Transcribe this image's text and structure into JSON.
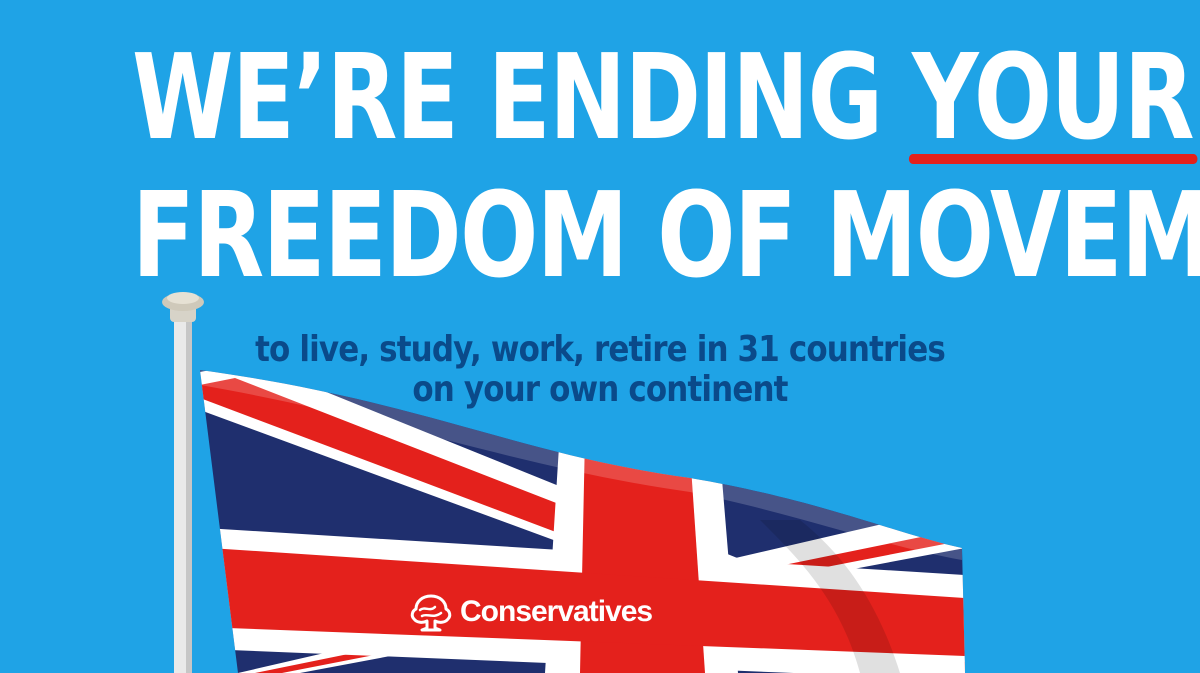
{
  "headline": {
    "line1_prefix": "WE’RE ENDING ",
    "line1_emphasis": "YOUR",
    "line2": "FREEDOM OF MOVEMENT"
  },
  "subheadline": {
    "line1": "to live, study, work, retire in 31 countries",
    "line2": "on your own continent"
  },
  "brand": {
    "name": "Conservatives",
    "logo_icon": "tree-logo-icon"
  },
  "flag_icon": "union-jack-flag",
  "colors": {
    "sky": "#1fa3e6",
    "headline_text": "#ffffff",
    "subhead_text": "#0a4a8a",
    "underline": "#e4211c",
    "flag_red": "#e4211c",
    "flag_blue": "#1f2f6e",
    "flag_white": "#ffffff"
  }
}
